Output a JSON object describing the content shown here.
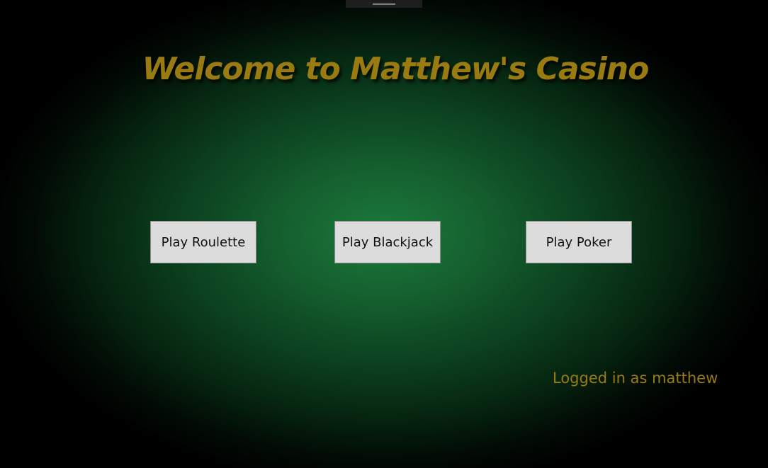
{
  "window": {
    "drag_handle_icon": "grip-lines-icon"
  },
  "title": "Welcome to Matthew's Casino",
  "buttons": {
    "roulette": "Play Roulette",
    "blackjack": "Play Blackjack",
    "poker": "Play Poker"
  },
  "status": {
    "logged_in": "Logged in as matthew"
  },
  "colors": {
    "felt_green": "#1c7a3c",
    "gold": "#9a7b12",
    "button_bg": "#dcdcdc"
  }
}
